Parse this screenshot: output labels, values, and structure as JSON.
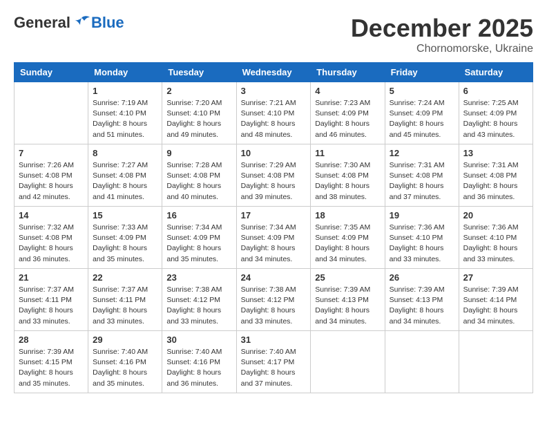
{
  "header": {
    "logo": {
      "general": "General",
      "blue": "Blue"
    },
    "title": "December 2025",
    "subtitle": "Chornomorske, Ukraine"
  },
  "calendar": {
    "weekdays": [
      "Sunday",
      "Monday",
      "Tuesday",
      "Wednesday",
      "Thursday",
      "Friday",
      "Saturday"
    ],
    "weeks": [
      [
        null,
        {
          "day": 1,
          "sunrise": "7:19 AM",
          "sunset": "4:10 PM",
          "daylight": "8 hours and 51 minutes."
        },
        {
          "day": 2,
          "sunrise": "7:20 AM",
          "sunset": "4:10 PM",
          "daylight": "8 hours and 49 minutes."
        },
        {
          "day": 3,
          "sunrise": "7:21 AM",
          "sunset": "4:10 PM",
          "daylight": "8 hours and 48 minutes."
        },
        {
          "day": 4,
          "sunrise": "7:23 AM",
          "sunset": "4:09 PM",
          "daylight": "8 hours and 46 minutes."
        },
        {
          "day": 5,
          "sunrise": "7:24 AM",
          "sunset": "4:09 PM",
          "daylight": "8 hours and 45 minutes."
        },
        {
          "day": 6,
          "sunrise": "7:25 AM",
          "sunset": "4:09 PM",
          "daylight": "8 hours and 43 minutes."
        }
      ],
      [
        {
          "day": 7,
          "sunrise": "7:26 AM",
          "sunset": "4:08 PM",
          "daylight": "8 hours and 42 minutes."
        },
        {
          "day": 8,
          "sunrise": "7:27 AM",
          "sunset": "4:08 PM",
          "daylight": "8 hours and 41 minutes."
        },
        {
          "day": 9,
          "sunrise": "7:28 AM",
          "sunset": "4:08 PM",
          "daylight": "8 hours and 40 minutes."
        },
        {
          "day": 10,
          "sunrise": "7:29 AM",
          "sunset": "4:08 PM",
          "daylight": "8 hours and 39 minutes."
        },
        {
          "day": 11,
          "sunrise": "7:30 AM",
          "sunset": "4:08 PM",
          "daylight": "8 hours and 38 minutes."
        },
        {
          "day": 12,
          "sunrise": "7:31 AM",
          "sunset": "4:08 PM",
          "daylight": "8 hours and 37 minutes."
        },
        {
          "day": 13,
          "sunrise": "7:31 AM",
          "sunset": "4:08 PM",
          "daylight": "8 hours and 36 minutes."
        }
      ],
      [
        {
          "day": 14,
          "sunrise": "7:32 AM",
          "sunset": "4:08 PM",
          "daylight": "8 hours and 36 minutes."
        },
        {
          "day": 15,
          "sunrise": "7:33 AM",
          "sunset": "4:09 PM",
          "daylight": "8 hours and 35 minutes."
        },
        {
          "day": 16,
          "sunrise": "7:34 AM",
          "sunset": "4:09 PM",
          "daylight": "8 hours and 35 minutes."
        },
        {
          "day": 17,
          "sunrise": "7:34 AM",
          "sunset": "4:09 PM",
          "daylight": "8 hours and 34 minutes."
        },
        {
          "day": 18,
          "sunrise": "7:35 AM",
          "sunset": "4:09 PM",
          "daylight": "8 hours and 34 minutes."
        },
        {
          "day": 19,
          "sunrise": "7:36 AM",
          "sunset": "4:10 PM",
          "daylight": "8 hours and 33 minutes."
        },
        {
          "day": 20,
          "sunrise": "7:36 AM",
          "sunset": "4:10 PM",
          "daylight": "8 hours and 33 minutes."
        }
      ],
      [
        {
          "day": 21,
          "sunrise": "7:37 AM",
          "sunset": "4:11 PM",
          "daylight": "8 hours and 33 minutes."
        },
        {
          "day": 22,
          "sunrise": "7:37 AM",
          "sunset": "4:11 PM",
          "daylight": "8 hours and 33 minutes."
        },
        {
          "day": 23,
          "sunrise": "7:38 AM",
          "sunset": "4:12 PM",
          "daylight": "8 hours and 33 minutes."
        },
        {
          "day": 24,
          "sunrise": "7:38 AM",
          "sunset": "4:12 PM",
          "daylight": "8 hours and 33 minutes."
        },
        {
          "day": 25,
          "sunrise": "7:39 AM",
          "sunset": "4:13 PM",
          "daylight": "8 hours and 34 minutes."
        },
        {
          "day": 26,
          "sunrise": "7:39 AM",
          "sunset": "4:13 PM",
          "daylight": "8 hours and 34 minutes."
        },
        {
          "day": 27,
          "sunrise": "7:39 AM",
          "sunset": "4:14 PM",
          "daylight": "8 hours and 34 minutes."
        }
      ],
      [
        {
          "day": 28,
          "sunrise": "7:39 AM",
          "sunset": "4:15 PM",
          "daylight": "8 hours and 35 minutes."
        },
        {
          "day": 29,
          "sunrise": "7:40 AM",
          "sunset": "4:16 PM",
          "daylight": "8 hours and 35 minutes."
        },
        {
          "day": 30,
          "sunrise": "7:40 AM",
          "sunset": "4:16 PM",
          "daylight": "8 hours and 36 minutes."
        },
        {
          "day": 31,
          "sunrise": "7:40 AM",
          "sunset": "4:17 PM",
          "daylight": "8 hours and 37 minutes."
        },
        null,
        null,
        null
      ]
    ]
  }
}
